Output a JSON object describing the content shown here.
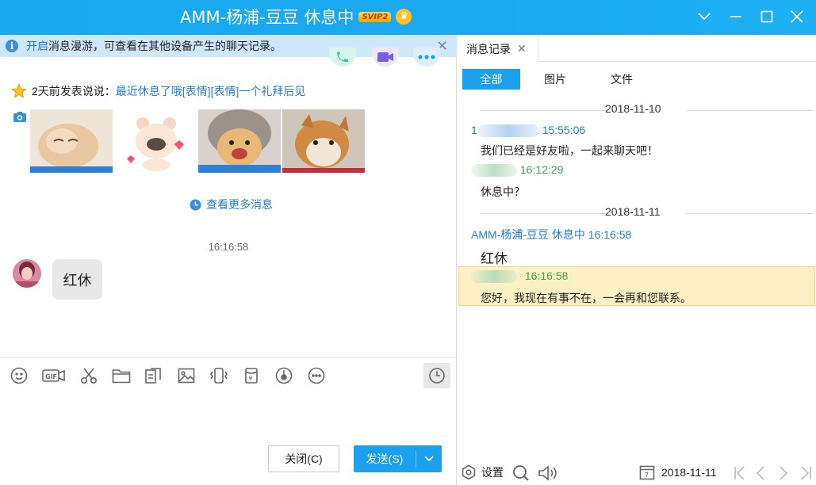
{
  "window": {
    "title": "AMM-杨浦-豆豆 休息中",
    "badge": "SVIP2",
    "crown_symbol": "♛"
  },
  "notice": {
    "link": "开启",
    "text": "消息漫游，可查看在其他设备产生的聊天记录。",
    "close": "✕"
  },
  "mood": {
    "prefix": "2天前发表说说：",
    "content": "最近休息了哦[表情][表情]一个礼拜后见"
  },
  "chat": {
    "more_messages": "查看更多消息",
    "time": "16:16:58",
    "message": "红休"
  },
  "buttons": {
    "close": "关闭(C)",
    "send": "发送(S)"
  },
  "history": {
    "tab": "消息记录",
    "tab_close": "✕",
    "filters": [
      "全部",
      "图片",
      "文件"
    ],
    "groups": [
      {
        "date": "2018-11-10",
        "entries": [
          {
            "sender_prefix": "1",
            "time": "15:55:06",
            "text": "我们已经是好友啦，一起来聊天吧！"
          },
          {
            "sender_prefix": "",
            "time": "16:12:29",
            "text": "休息中？"
          }
        ]
      },
      {
        "date": "2018-11-11",
        "entries": [
          {
            "sender": "AMM-杨浦-豆豆 休息中",
            "time": "16:16:58",
            "text": "红休"
          },
          {
            "sender_prefix": "",
            "time": "16:16:58",
            "text": "您好，我现在有事不在，一会再和您联系。"
          }
        ]
      }
    ],
    "settings": "设置",
    "date_calendar_day": "7",
    "date": "2018-11-11"
  },
  "colors": {
    "titlebar": "#1ba9f0",
    "accent": "#1aa0ef",
    "link": "#1f7ed6",
    "highlight": "#fdf0c4",
    "self_name": "#3aa84a"
  }
}
